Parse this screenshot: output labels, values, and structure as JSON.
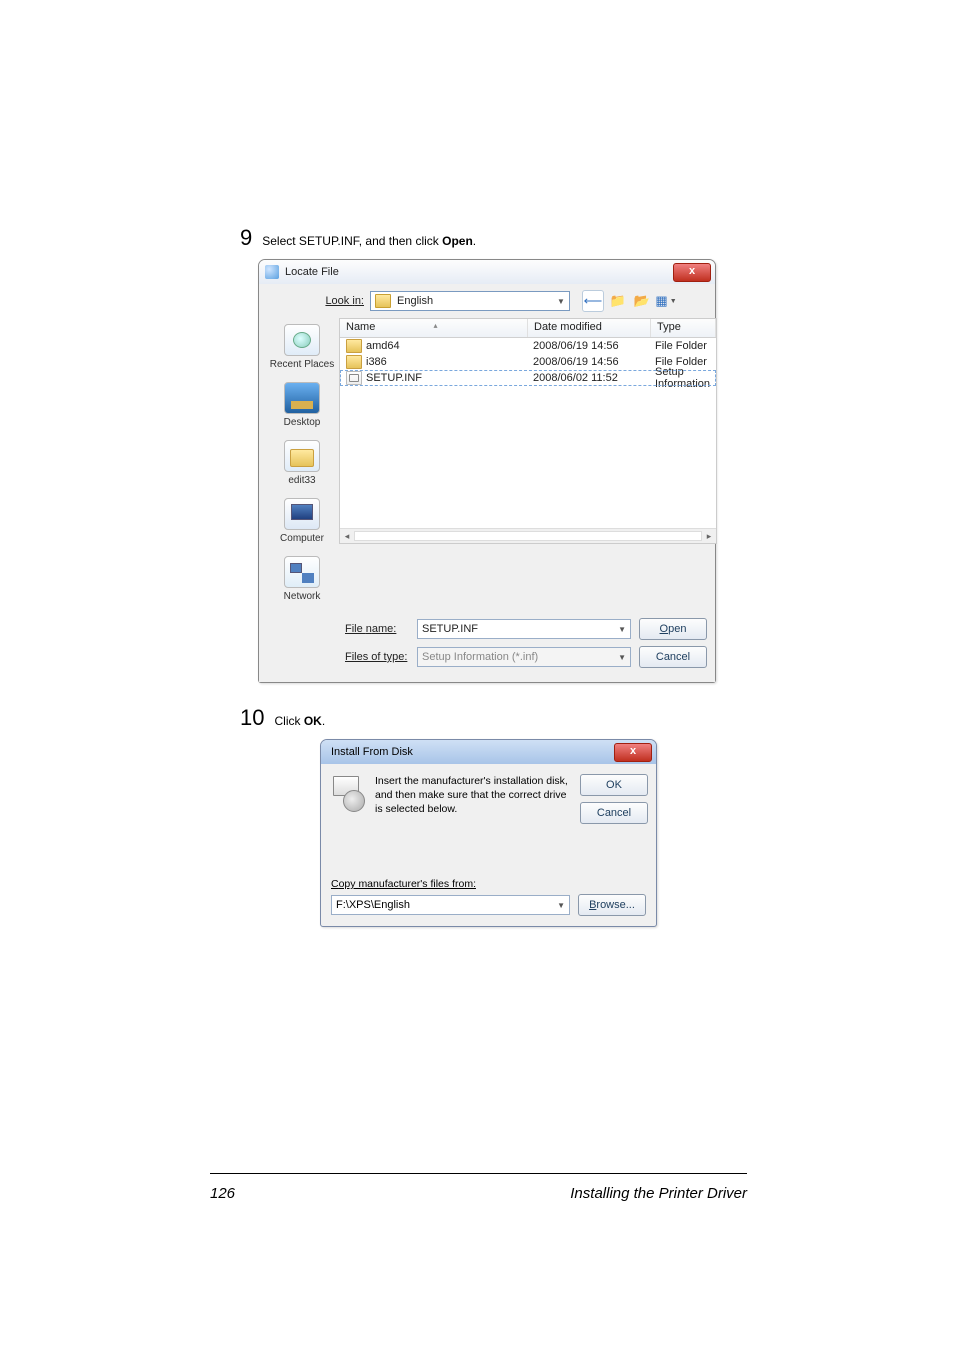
{
  "step9": {
    "num": "9",
    "text_prefix": "Select SETUP.INF, and then click ",
    "bold": "Open",
    "text_suffix": "."
  },
  "step10": {
    "num": "10",
    "text_prefix": "Click ",
    "bold": "OK",
    "text_suffix": "."
  },
  "locate": {
    "title": "Locate File",
    "close_glyph": "x",
    "look_in_label_pre": "Look ",
    "look_in_label_u": "i",
    "look_in_label_post": "n:",
    "look_in_value": "English",
    "columns": {
      "name": "Name",
      "date": "Date modified",
      "type": "Type"
    },
    "rows": [
      {
        "name": "amd64",
        "date": "2008/06/19 14:56",
        "type": "File Folder",
        "icon": "folder"
      },
      {
        "name": "i386",
        "date": "2008/06/19 14:56",
        "type": "File Folder",
        "icon": "folder"
      },
      {
        "name": "SETUP.INF",
        "date": "2008/06/02 11:52",
        "type": "Setup Information",
        "icon": "inf"
      }
    ],
    "places": [
      {
        "label": "Recent Places",
        "cls": "recent"
      },
      {
        "label": "Desktop",
        "cls": "desktop"
      },
      {
        "label": "edit33",
        "cls": "folder"
      },
      {
        "label": "Computer",
        "cls": "computer"
      },
      {
        "label": "Network",
        "cls": "network"
      }
    ],
    "filename_label_pre": "File ",
    "filename_label_u": "n",
    "filename_label_post": "ame:",
    "filename_value": "SETUP.INF",
    "filetype_label_pre": "Files of ",
    "filetype_label_u": "t",
    "filetype_label_post": "ype:",
    "filetype_value": "Setup Information (*.inf)",
    "open_u": "O",
    "open_rest": "pen",
    "cancel": "Cancel"
  },
  "ifd": {
    "title": "Install From Disk",
    "close_glyph": "x",
    "message": "Insert the manufacturer's installation disk, and then make sure that the correct drive is selected below.",
    "ok": "OK",
    "cancel": "Cancel",
    "copy_pre": "",
    "copy_u": "C",
    "copy_post": "opy manufacturer's files from:",
    "path": "F:\\XPS\\English",
    "browse_u": "B",
    "browse_rest": "rowse..."
  },
  "footer": {
    "page": "126",
    "title": "Installing the Printer Driver"
  }
}
